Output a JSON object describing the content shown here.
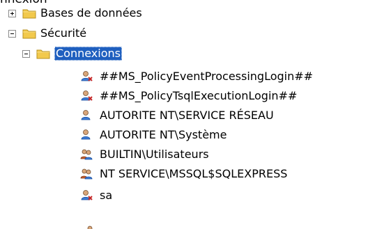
{
  "top_fragment": "nnexion",
  "tree": {
    "databases": {
      "label": "Bases de données",
      "expanded": false
    },
    "security": {
      "label": "Sécurité",
      "expanded": true
    },
    "logins": {
      "label": "Connexions",
      "expanded": true,
      "selected": true
    },
    "items": [
      {
        "label": "##MS_PolicyEventProcessingLogin##",
        "icon": "disabled-user-login-icon"
      },
      {
        "label": "##MS_PolicyTsqlExecutionLogin##",
        "icon": "disabled-user-login-icon"
      },
      {
        "label": "AUTORITE NT\\SERVICE RÉSEAU",
        "icon": "user-login-icon"
      },
      {
        "label": "AUTORITE NT\\Système",
        "icon": "user-login-icon"
      },
      {
        "label": "BUILTIN\\Utilisateurs",
        "icon": "group-login-icon"
      },
      {
        "label": "NT SERVICE\\MSSQL$SQLEXPRESS",
        "icon": "group-login-icon"
      },
      {
        "label": "sa",
        "icon": "disabled-user-login-icon"
      }
    ]
  },
  "colors": {
    "selection": "#1f5fbf",
    "folder": "#f2c94c",
    "user": "#3c7bd6",
    "disabled_badge": "#c62828"
  }
}
